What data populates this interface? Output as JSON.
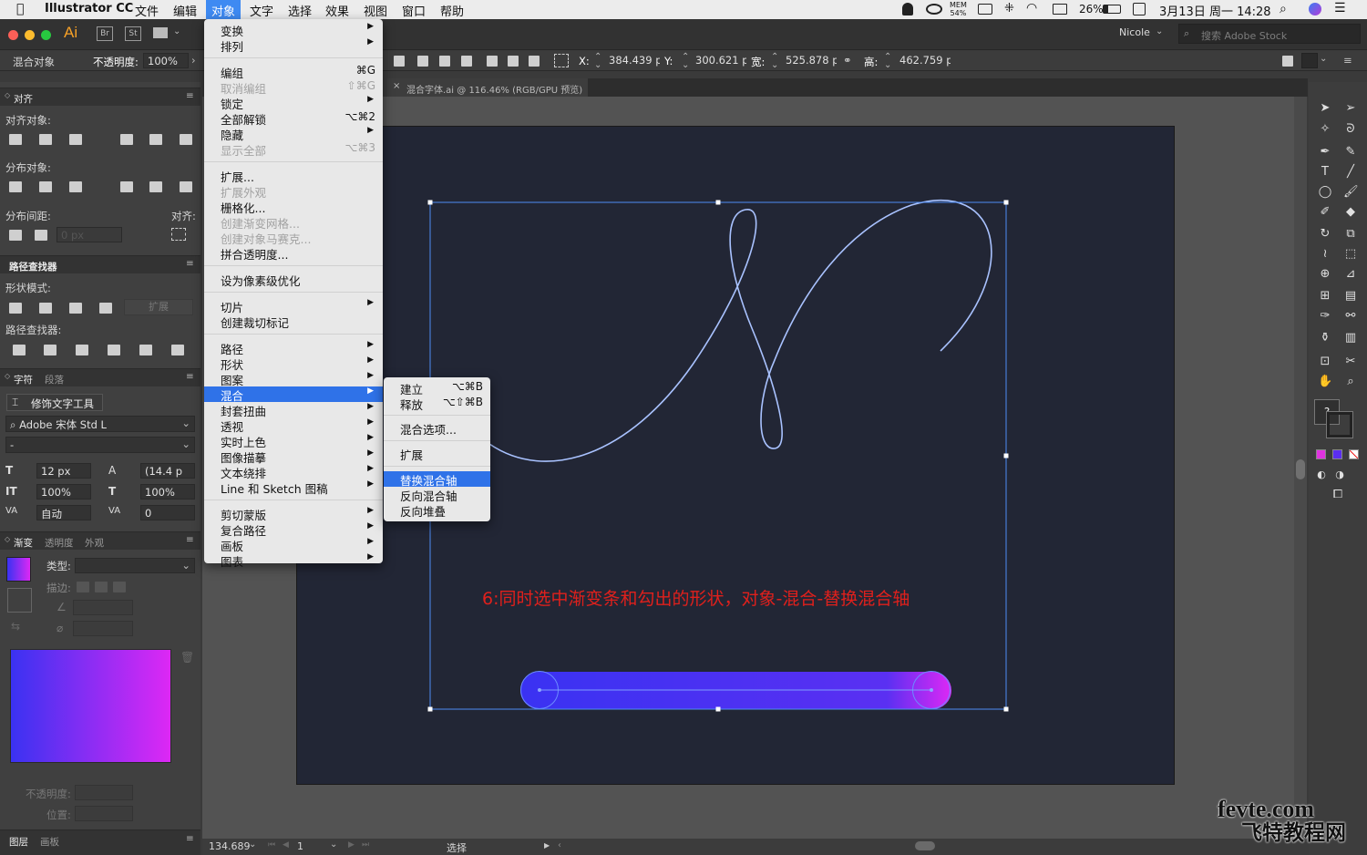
{
  "menubar": {
    "apple": "",
    "app": "Illustrator CC",
    "items": [
      "文件",
      "编辑",
      "对象",
      "文字",
      "选择",
      "效果",
      "视图",
      "窗口",
      "帮助"
    ],
    "mem_label": "MEM",
    "mem_value": "54%",
    "battery": "26%",
    "datetime": "3月13日 周一 14:28"
  },
  "titlebar": {
    "logo": "Ai",
    "br": "Br",
    "st": "St",
    "user": "Nicole",
    "search_placeholder": "搜索 Adobe Stock"
  },
  "controlbar": {
    "mode": "混合对象",
    "opacity_label": "不透明度:",
    "opacity_value": "100%",
    "x_label": "X:",
    "x_value": "384.439 p",
    "y_label": "Y:",
    "y_value": "300.621 p",
    "w_label": "宽:",
    "w_value": "525.878 p",
    "h_label": "高:",
    "h_value": "462.759 p"
  },
  "tab": {
    "close": "×",
    "title": "混合字体.ai @ 116.46% (RGB/GPU 预览)"
  },
  "align_panel": {
    "title": "对齐",
    "align_objects": "对齐对象:",
    "distribute_objects": "分布对象:",
    "distribute_spacing": "分布间距:",
    "align_to": "对齐:",
    "spacing_value": "0 px"
  },
  "pathfinder_panel": {
    "title": "路径查找器",
    "shape_modes": "形状模式:",
    "expand": "扩展",
    "pathfinders": "路径查找器:"
  },
  "char_panel": {
    "tab1": "字符",
    "tab2": "段落",
    "touch_type": "修饰文字工具",
    "font": "Adobe 宋体 Std L",
    "style": "-",
    "size": "12 px",
    "leading": "(14.4 p",
    "vscale": "100%",
    "hscale": "100%",
    "kerning": "自动",
    "tracking": "0"
  },
  "gradient_panel": {
    "tab1": "渐变",
    "tab2": "透明度",
    "tab3": "外观",
    "type_label": "类型:",
    "stroke_label": "描边:",
    "opacity_label": "不透明度:",
    "position_label": "位置:",
    "gradient_start": "#3a32f2",
    "gradient_end": "#dd28f4"
  },
  "bottom_panel": {
    "tab1": "图层",
    "tab2": "画板"
  },
  "object_menu": {
    "items": [
      {
        "label": "变换",
        "shortcut": "",
        "arrow": "▶",
        "disabled": false
      },
      {
        "label": "排列",
        "shortcut": "",
        "arrow": "▶",
        "disabled": false
      },
      {
        "label": "编组",
        "shortcut": "⌘G",
        "arrow": "",
        "disabled": false
      },
      {
        "label": "取消编组",
        "shortcut": "⇧⌘G",
        "arrow": "",
        "disabled": true
      },
      {
        "label": "锁定",
        "shortcut": "",
        "arrow": "▶",
        "disabled": false
      },
      {
        "label": "全部解锁",
        "shortcut": "⌥⌘2",
        "arrow": "",
        "disabled": false
      },
      {
        "label": "隐藏",
        "shortcut": "",
        "arrow": "▶",
        "disabled": false
      },
      {
        "label": "显示全部",
        "shortcut": "⌥⌘3",
        "arrow": "",
        "disabled": true
      },
      {
        "label": "扩展...",
        "shortcut": "",
        "arrow": "",
        "disabled": false
      },
      {
        "label": "扩展外观",
        "shortcut": "",
        "arrow": "",
        "disabled": true
      },
      {
        "label": "栅格化...",
        "shortcut": "",
        "arrow": "",
        "disabled": false
      },
      {
        "label": "创建渐变网格...",
        "shortcut": "",
        "arrow": "",
        "disabled": true
      },
      {
        "label": "创建对象马赛克...",
        "shortcut": "",
        "arrow": "",
        "disabled": true
      },
      {
        "label": "拼合透明度...",
        "shortcut": "",
        "arrow": "",
        "disabled": false
      },
      {
        "label": "设为像素级优化",
        "shortcut": "",
        "arrow": "",
        "disabled": false
      },
      {
        "label": "切片",
        "shortcut": "",
        "arrow": "▶",
        "disabled": false
      },
      {
        "label": "创建裁切标记",
        "shortcut": "",
        "arrow": "",
        "disabled": false
      },
      {
        "label": "路径",
        "shortcut": "",
        "arrow": "▶",
        "disabled": false
      },
      {
        "label": "形状",
        "shortcut": "",
        "arrow": "▶",
        "disabled": false
      },
      {
        "label": "图案",
        "shortcut": "",
        "arrow": "▶",
        "disabled": false
      },
      {
        "label": "混合",
        "shortcut": "",
        "arrow": "▶",
        "disabled": false
      },
      {
        "label": "封套扭曲",
        "shortcut": "",
        "arrow": "▶",
        "disabled": false
      },
      {
        "label": "透视",
        "shortcut": "",
        "arrow": "▶",
        "disabled": false
      },
      {
        "label": "实时上色",
        "shortcut": "",
        "arrow": "▶",
        "disabled": false
      },
      {
        "label": "图像描摹",
        "shortcut": "",
        "arrow": "▶",
        "disabled": false
      },
      {
        "label": "文本绕排",
        "shortcut": "",
        "arrow": "▶",
        "disabled": false
      },
      {
        "label": "Line 和 Sketch 图稿",
        "shortcut": "",
        "arrow": "▶",
        "disabled": false
      },
      {
        "label": "剪切蒙版",
        "shortcut": "",
        "arrow": "▶",
        "disabled": false
      },
      {
        "label": "复合路径",
        "shortcut": "",
        "arrow": "▶",
        "disabled": false
      },
      {
        "label": "画板",
        "shortcut": "",
        "arrow": "▶",
        "disabled": false
      },
      {
        "label": "图表",
        "shortcut": "",
        "arrow": "▶",
        "disabled": false
      }
    ],
    "highlighted": "混合"
  },
  "blend_submenu": {
    "items": [
      {
        "label": "建立",
        "shortcut": "⌥⌘B"
      },
      {
        "label": "释放",
        "shortcut": "⌥⇧⌘B"
      },
      {
        "label": "混合选项...",
        "shortcut": ""
      },
      {
        "label": "扩展",
        "shortcut": ""
      },
      {
        "label": "替换混合轴",
        "shortcut": ""
      },
      {
        "label": "反向混合轴",
        "shortcut": ""
      },
      {
        "label": "反向堆叠",
        "shortcut": ""
      }
    ],
    "highlighted": "替换混合轴"
  },
  "canvas": {
    "instruction": "6:同时选中渐变条和勾出的形状，对象-混合-替换混合轴",
    "instruction_color": "#e0201c",
    "curve_color": "#a9c2ff",
    "selection_color": "#4d8cf5"
  },
  "statusbar": {
    "zoom": "134.689",
    "page": "1",
    "tool": "选择"
  },
  "watermark": {
    "line1": "fevte.com",
    "line2": "飞特教程网"
  }
}
